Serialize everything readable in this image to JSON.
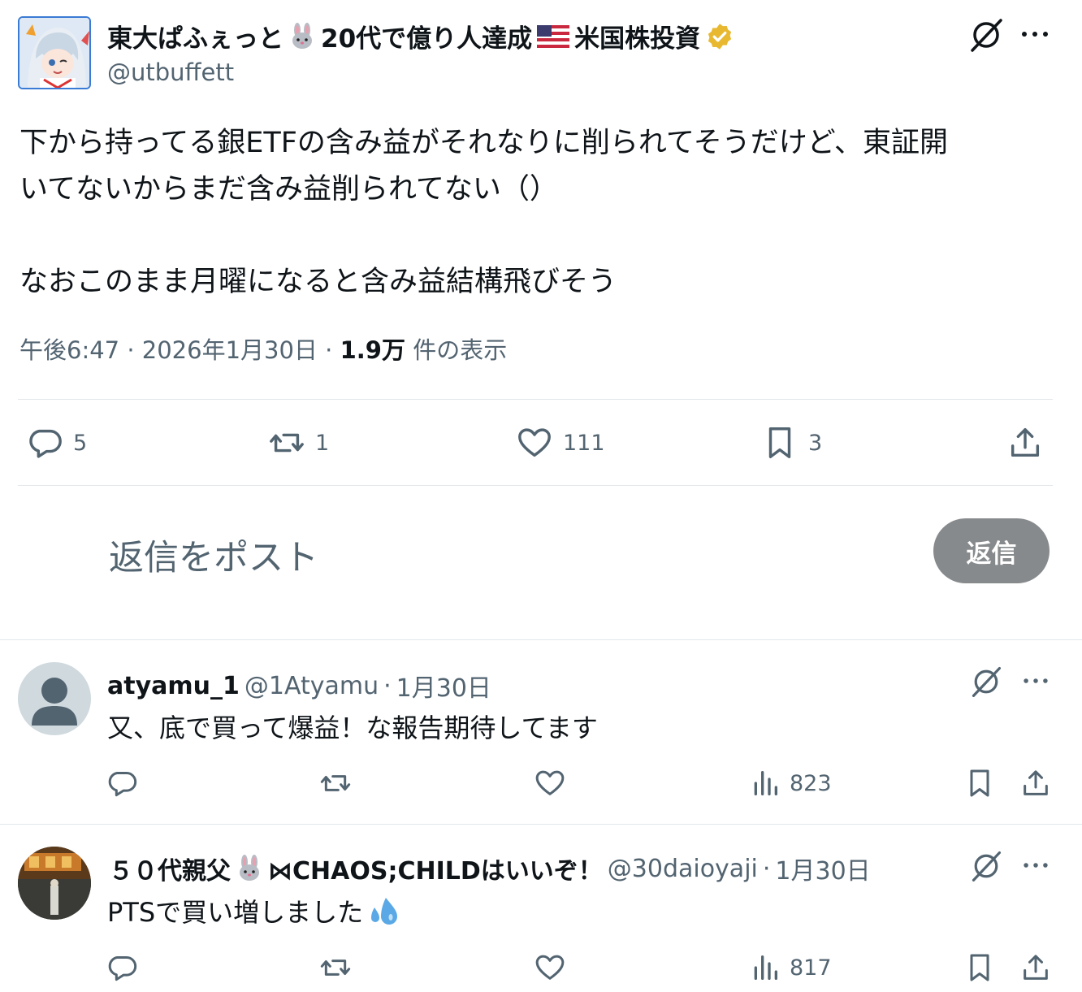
{
  "colors": {
    "text": "#0f1419",
    "secondary": "#536471",
    "divider": "#e3e7ea",
    "reply_button": "#878a8c",
    "verified": "#e8b830"
  },
  "main_tweet": {
    "display_name": "東大ぱふぇっと",
    "display_name_mid": "20代で億り人達成",
    "display_name_end": "米国株投資",
    "handle": "@utbuffett",
    "text": "下から持ってる銀ETFの含み益がそれなりに削られてそうだけど、東証開\nいてないからまだ含み益削られてない（）\n\nなおこのまま月曜になると含み益結構飛びそう",
    "time": "午後6:47",
    "date": "2026年1月30日",
    "views_count": "1.9万",
    "views_label": "件の表示",
    "sep": "·",
    "stats": {
      "replies": "5",
      "reposts": "1",
      "likes": "111",
      "bookmarks": "3"
    }
  },
  "reply_box": {
    "placeholder": "返信をポスト",
    "button_label": "返信"
  },
  "replies": [
    {
      "name": "atyamu_1",
      "handle": "@1Atyamu",
      "date": "1月30日",
      "sep": "·",
      "text": "又、底で買って爆益！な報告期待してます",
      "views": "823"
    },
    {
      "name": "５０代親父",
      "name_end": "⋈CHAOS;CHILDはいいぞ！",
      "handle": "@30daioyaji",
      "date": "1月30日",
      "sep": "·",
      "text": "PTSで買い増しました",
      "views": "817"
    }
  ]
}
